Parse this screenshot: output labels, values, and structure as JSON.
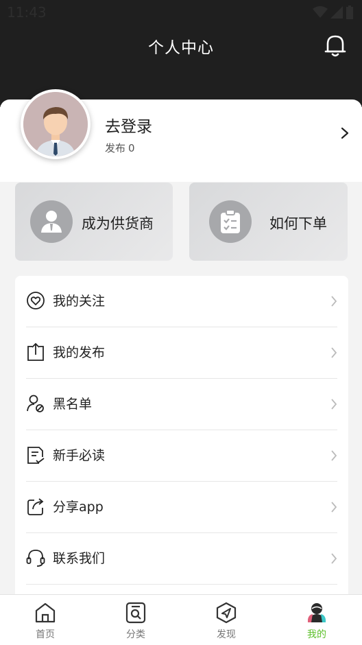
{
  "status_bar": {
    "time": "11:43"
  },
  "header": {
    "title": "个人中心"
  },
  "profile": {
    "login_label": "去登录",
    "post_label": "发布",
    "post_count": "0"
  },
  "promos": {
    "supplier_label": "成为供货商",
    "order_label": "如何下单"
  },
  "menu": {
    "items": [
      {
        "label": "我的关注",
        "icon": "heart-circle-icon"
      },
      {
        "label": "我的发布",
        "icon": "upload-icon"
      },
      {
        "label": "黑名单",
        "icon": "block-user-icon"
      },
      {
        "label": "新手必读",
        "icon": "document-icon"
      },
      {
        "label": "分享app",
        "icon": "share-icon"
      },
      {
        "label": "联系我们",
        "icon": "headset-icon"
      }
    ]
  },
  "tabbar": {
    "tabs": [
      {
        "label": "首页",
        "icon": "home-icon"
      },
      {
        "label": "分类",
        "icon": "category-icon"
      },
      {
        "label": "发现",
        "icon": "discover-icon"
      },
      {
        "label": "我的",
        "icon": "profile-icon"
      }
    ],
    "active_index": 3,
    "active_color": "#5dc02b"
  }
}
